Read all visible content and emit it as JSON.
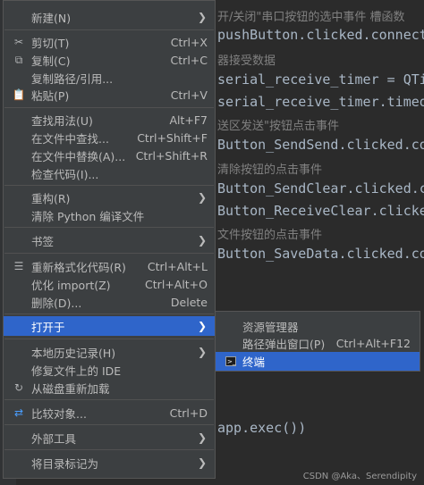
{
  "editor": {
    "code": [
      {
        "text": "开/关闭\"串口按钮的选中事件 槽函数",
        "kind": "comment"
      },
      {
        "text": "pushButton.clicked.connect",
        "kind": "code"
      },
      {
        "text": "器接受数据",
        "kind": "comment"
      },
      {
        "text": "serial_receive_timer = QTim",
        "kind": "code"
      },
      {
        "text": "serial_receive_timer.timeou",
        "kind": "code"
      },
      {
        "text": "送区发送\"按钮点击事件",
        "kind": "comment"
      },
      {
        "text": "Button_SendSend.clicked.co",
        "kind": "code"
      },
      {
        "text": "清除按钮的点击事件",
        "kind": "comment"
      },
      {
        "text": "Button_SendClear.clicked.co",
        "kind": "code"
      },
      {
        "text": "Button_ReceiveClear.clicke",
        "kind": "code"
      },
      {
        "text": "文件按钮的点击事件",
        "kind": "comment"
      },
      {
        "text": "Button_SaveData.clicked.con",
        "kind": "code"
      },
      {
        "text": "app.exec())",
        "kind": "code"
      }
    ],
    "watermark": "CSDN @Aka、Serendipity"
  },
  "menu": {
    "items": [
      {
        "label": "新建(N)",
        "shortcut": "",
        "submenu": true,
        "icon": ""
      },
      {
        "label": "剪切(T)",
        "shortcut": "Ctrl+X",
        "submenu": false,
        "icon": "scissors-icon"
      },
      {
        "label": "复制(C)",
        "shortcut": "Ctrl+C",
        "submenu": false,
        "icon": "copy-icon"
      },
      {
        "label": "复制路径/引用...",
        "shortcut": "",
        "submenu": false,
        "icon": ""
      },
      {
        "label": "粘贴(P)",
        "shortcut": "Ctrl+V",
        "submenu": false,
        "icon": "paste-icon"
      },
      {
        "label": "查找用法(U)",
        "shortcut": "Alt+F7",
        "submenu": false,
        "icon": ""
      },
      {
        "label": "在文件中查找...",
        "shortcut": "Ctrl+Shift+F",
        "submenu": false,
        "icon": ""
      },
      {
        "label": "在文件中替换(A)...",
        "shortcut": "Ctrl+Shift+R",
        "submenu": false,
        "icon": ""
      },
      {
        "label": "检查代码(I)...",
        "shortcut": "",
        "submenu": false,
        "icon": ""
      },
      {
        "label": "重构(R)",
        "shortcut": "",
        "submenu": true,
        "icon": ""
      },
      {
        "label": "清除 Python 编译文件",
        "shortcut": "",
        "submenu": false,
        "icon": ""
      },
      {
        "label": "书签",
        "shortcut": "",
        "submenu": true,
        "icon": ""
      },
      {
        "label": "重新格式化代码(R)",
        "shortcut": "Ctrl+Alt+L",
        "submenu": false,
        "icon": "format-icon"
      },
      {
        "label": "优化 import(Z)",
        "shortcut": "Ctrl+Alt+O",
        "submenu": false,
        "icon": ""
      },
      {
        "label": "删除(D)...",
        "shortcut": "Delete",
        "submenu": false,
        "icon": ""
      },
      {
        "label": "打开于",
        "shortcut": "",
        "submenu": true,
        "icon": ""
      },
      {
        "label": "本地历史记录(H)",
        "shortcut": "",
        "submenu": true,
        "icon": ""
      },
      {
        "label": "修复文件上的 IDE",
        "shortcut": "",
        "submenu": false,
        "icon": ""
      },
      {
        "label": "从磁盘重新加载",
        "shortcut": "",
        "submenu": false,
        "icon": "reload-icon"
      },
      {
        "label": "比较对象...",
        "shortcut": "Ctrl+D",
        "submenu": false,
        "icon": "compare-icon"
      },
      {
        "label": "外部工具",
        "shortcut": "",
        "submenu": true,
        "icon": ""
      },
      {
        "label": "将目录标记为",
        "shortcut": "",
        "submenu": true,
        "icon": ""
      }
    ]
  },
  "submenu": {
    "items": [
      {
        "label": "资源管理器",
        "shortcut": ""
      },
      {
        "label": "路径弹出窗口(P)",
        "shortcut": "Ctrl+Alt+F12"
      },
      {
        "label": "终端",
        "shortcut": ""
      }
    ]
  },
  "colors": {
    "menu_bg": "#3c3f41",
    "selection": "#2f65ca",
    "editor_bg": "#2b2b2b"
  }
}
